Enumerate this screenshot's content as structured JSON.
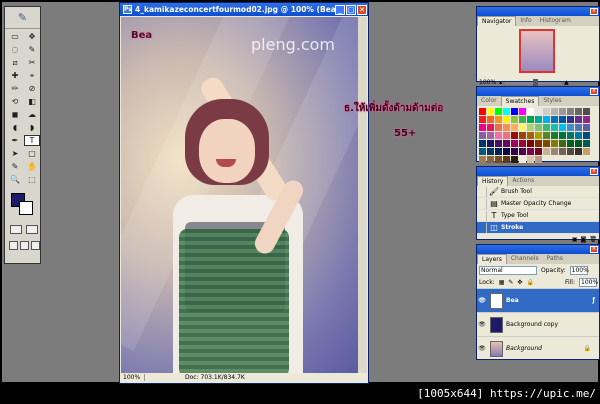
{
  "document": {
    "title": "4_kamikazeconcertfourmod02.jpg @ 100% (Bea, ...",
    "zoom": "100%",
    "doc_size": "Doc: 703.1K/834.7K",
    "canvas_text": "Bea",
    "watermark": "pleng.com",
    "watermark_sub": "pleng.com"
  },
  "annotations": {
    "line1": "ธ.ให้เพิ่มดั้งด้ามด้ามต่อ",
    "line2": "55+"
  },
  "toolbox": {
    "tools": [
      "▭",
      "✥",
      "◌",
      "✎",
      "⧄",
      "✂",
      "✚",
      "⌖",
      "✏",
      "⊘",
      "⟲",
      "◧",
      "◼",
      "☁",
      "◖",
      "◗",
      "✒",
      "T",
      "➤",
      "▢",
      "✎",
      "✋",
      "🔍",
      "⬚"
    ]
  },
  "navigator": {
    "tabs": [
      "Navigator",
      "Info",
      "Histogram"
    ],
    "zoom": "100%"
  },
  "swatches": {
    "tabs": [
      "Color",
      "Swatches",
      "Styles"
    ],
    "colors": [
      "#ff0000",
      "#ffff00",
      "#00ff00",
      "#00ffff",
      "#0000ff",
      "#ff00ff",
      "#ffffff",
      "#e6e6e6",
      "#cccccc",
      "#b3b3b3",
      "#999999",
      "#808080",
      "#666666",
      "#4d4d4d",
      "#ee1d24",
      "#f26522",
      "#f7941d",
      "#fff200",
      "#8dc63f",
      "#39b54a",
      "#00a651",
      "#00a99d",
      "#00aeef",
      "#0072bc",
      "#0054a6",
      "#2e3192",
      "#662d91",
      "#92278f",
      "#ec008c",
      "#ed145b",
      "#f26c4f",
      "#f68e56",
      "#fbaf5d",
      "#fff568",
      "#acd373",
      "#7cc576",
      "#3cb878",
      "#1cbbb4",
      "#00bff3",
      "#448ccb",
      "#5674b9",
      "#605ca8",
      "#855fa8",
      "#a763a8",
      "#f06eaa",
      "#f26d7d",
      "#9e0b0f",
      "#a0410d",
      "#a3620a",
      "#aba000",
      "#598527",
      "#197b30",
      "#007236",
      "#00746b",
      "#0076a3",
      "#004a80",
      "#003471",
      "#1b1464",
      "#440e62",
      "#630460",
      "#9e005d",
      "#9e0039",
      "#790000",
      "#7b2e00",
      "#7d4900",
      "#827b00",
      "#406618",
      "#005e20",
      "#005826",
      "#005952",
      "#005b7f",
      "#003663",
      "#002157",
      "#0d004c",
      "#32004b",
      "#4b0049",
      "#7b0046",
      "#7a0026",
      "#c7b299",
      "#998675",
      "#736357",
      "#534741",
      "#37302d",
      "#c69c6d",
      "#a67c52",
      "#8c6239",
      "#754c24",
      "#603913",
      "#2b1c10",
      "#f4e8d9",
      "#d7c4ab",
      "#b59b81"
    ]
  },
  "history": {
    "tabs": [
      "History",
      "Actions"
    ],
    "items": [
      {
        "icon": "🖌",
        "label": "Brush Tool"
      },
      {
        "icon": "▤",
        "label": "Master Opacity Change"
      },
      {
        "icon": "T",
        "label": "Type Tool"
      },
      {
        "icon": "◫",
        "label": "Stroke"
      }
    ]
  },
  "layers": {
    "tabs": [
      "Layers",
      "Channels",
      "Paths"
    ],
    "blend_mode": "Normal",
    "opacity_label": "Opacity:",
    "opacity_value": "100%",
    "lock_label": "Lock:",
    "fill_label": "Fill:",
    "fill_value": "100%",
    "items": [
      {
        "name": "Bea",
        "thumb": "T"
      },
      {
        "name": "Background copy",
        "thumb": ""
      },
      {
        "name": "Background",
        "thumb": ""
      }
    ]
  },
  "footer": {
    "text": "[1005x644] https://upic.me/"
  }
}
